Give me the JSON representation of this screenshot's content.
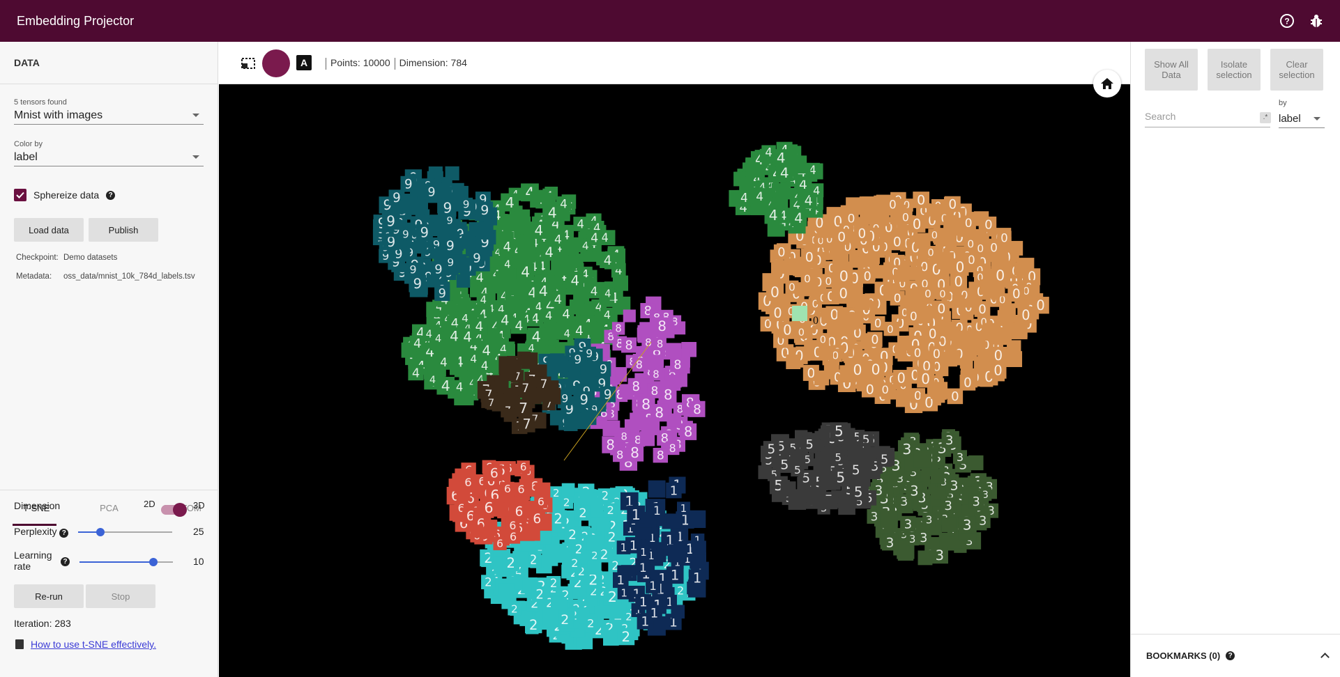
{
  "app": {
    "title": "Embedding Projector",
    "brand_color": "#4e0a31"
  },
  "header_icons": [
    "help-icon",
    "bug-icon"
  ],
  "data_panel": {
    "section_title": "DATA",
    "tensors_label": "5 tensors found",
    "tensor_value": "Mnist with images",
    "color_by_label": "Color by",
    "color_by_value": "label",
    "sphereize_label": "Sphereize data",
    "sphereize_checked": true,
    "load_label": "Load data",
    "publish_label": "Publish",
    "checkpoint_key": "Checkpoint:",
    "checkpoint_value": "Demo datasets",
    "metadata_key": "Metadata:",
    "metadata_value": "oss_data/mnist_10k_784d_labels.tsv"
  },
  "projection": {
    "tabs": [
      "T-SNE",
      "PCA",
      "CUSTOM"
    ],
    "active_tab": "T-SNE",
    "dimension_label": "Dimension",
    "dim_2d": "2D",
    "dim_3d": "3D",
    "perplexity_label": "Perplexity",
    "perplexity_value": "25",
    "learning_rate_label_1": "Learning",
    "learning_rate_label_2": "rate",
    "learning_rate_value": "10",
    "rerun_label": "Re-run",
    "stop_label": "Stop",
    "iteration_text": "Iteration: 283",
    "help_link": "How to use t-SNE effectively."
  },
  "toolbar": {
    "points": "Points: 10000",
    "dimension": "Dimension: 784",
    "tool_icons": [
      "selection-box-icon",
      "night-mode-icon",
      "labels-icon"
    ]
  },
  "canvas": {
    "highlight_label": "0",
    "cluster_colors": {
      "zero": "#d28e4e",
      "four": "#2a8a3e",
      "nine": "#0e5a66",
      "two": "#2fc4c4",
      "three": "#3b5a30",
      "five": "#3a3a3a",
      "six": "#d24a3a",
      "eight": "#b04fc0",
      "seven": "#3a2a1a",
      "one": "#0e2a55"
    }
  },
  "inspector": {
    "show_all": "Show All Data",
    "isolate": "Isolate selection",
    "clear": "Clear selection",
    "search_placeholder": "Search",
    "regex": ".*",
    "by_label": "by",
    "by_value": "label",
    "bookmarks": "BOOKMARKS (0)"
  }
}
